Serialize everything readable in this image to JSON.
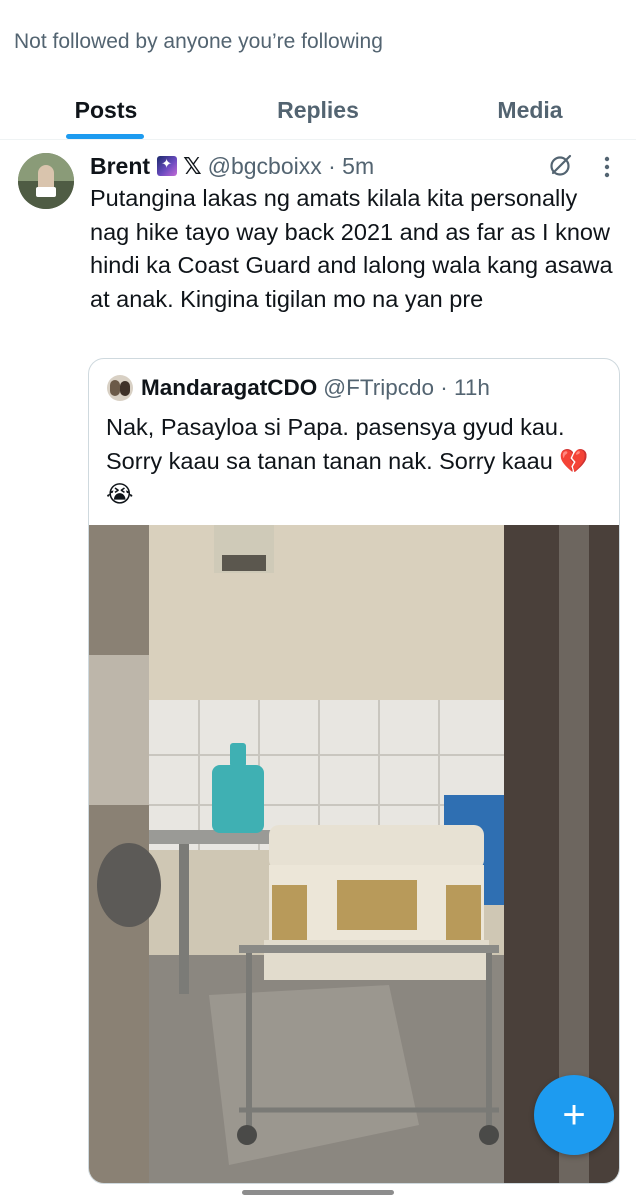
{
  "profile": {
    "follow_note": "Not followed by anyone you’re following"
  },
  "tabs": [
    {
      "label": "Posts",
      "active": true
    },
    {
      "label": "Replies",
      "active": false
    },
    {
      "label": "Media",
      "active": false
    }
  ],
  "tweet": {
    "author": "Brent",
    "badge_icon": "milky-way-emoji",
    "x_glyph": "𝕏",
    "handle_time": "@bgcboixx · 5m",
    "text": "Putangina lakas ng amats kilala kita personally nag hike tayo way back 2021 and as far as I know hindi ka Coast Guard and lalong wala kang asawa at anak. Kingina tigilan mo na yan pre",
    "icons": [
      "grok-icon",
      "more-vertical-icon"
    ],
    "quote": {
      "author": "MandaragatCDO",
      "handle_time": "@FTripcdo · 11h",
      "text": "Nak, Pasayloa si Papa. pasensya gyud kau. Sorry kaau sa tanan tanan nak. Sorry kaau 💔😭",
      "media_description_icon": "photo"
    }
  },
  "compose_button": {
    "label": "+"
  },
  "colors": {
    "accent": "#1d9bf0",
    "text_primary": "#0f1419",
    "text_secondary": "#536471",
    "border": "#cfd9de"
  }
}
